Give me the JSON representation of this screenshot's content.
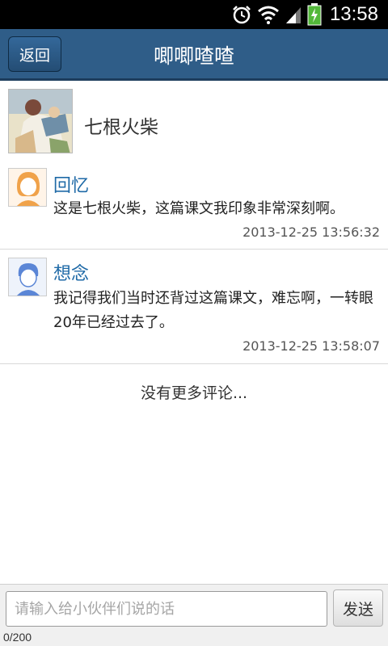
{
  "status_bar": {
    "time": "13:58",
    "icons": [
      "alarm-icon",
      "wifi-icon",
      "signal-icon",
      "battery-charging-icon"
    ]
  },
  "header": {
    "back_label": "返回",
    "title": "唧唧喳喳"
  },
  "post": {
    "title": "七根火柴",
    "cover": "post-cover-image"
  },
  "comments": [
    {
      "name": "回忆",
      "text": "这是七根火柴，这篇课文我印象非常深刻啊。",
      "time": "2013-12-25 13:56:32",
      "avatar": "female-avatar-icon",
      "avatar_color": "#f0a24a"
    },
    {
      "name": "想念",
      "text": "我记得我们当时还背过这篇课文，难忘啊，一转眼20年已经过去了。",
      "time": "2013-12-25 13:58:07",
      "avatar": "male-avatar-icon",
      "avatar_color": "#5b86d6"
    }
  ],
  "no_more_text": "没有更多评论...",
  "composer": {
    "placeholder": "请输入给小伙伴们说的话",
    "send_label": "发送",
    "counter": "0/200"
  },
  "colors": {
    "header_bg": "#2f5d88",
    "name_color": "#1f6aa7"
  }
}
